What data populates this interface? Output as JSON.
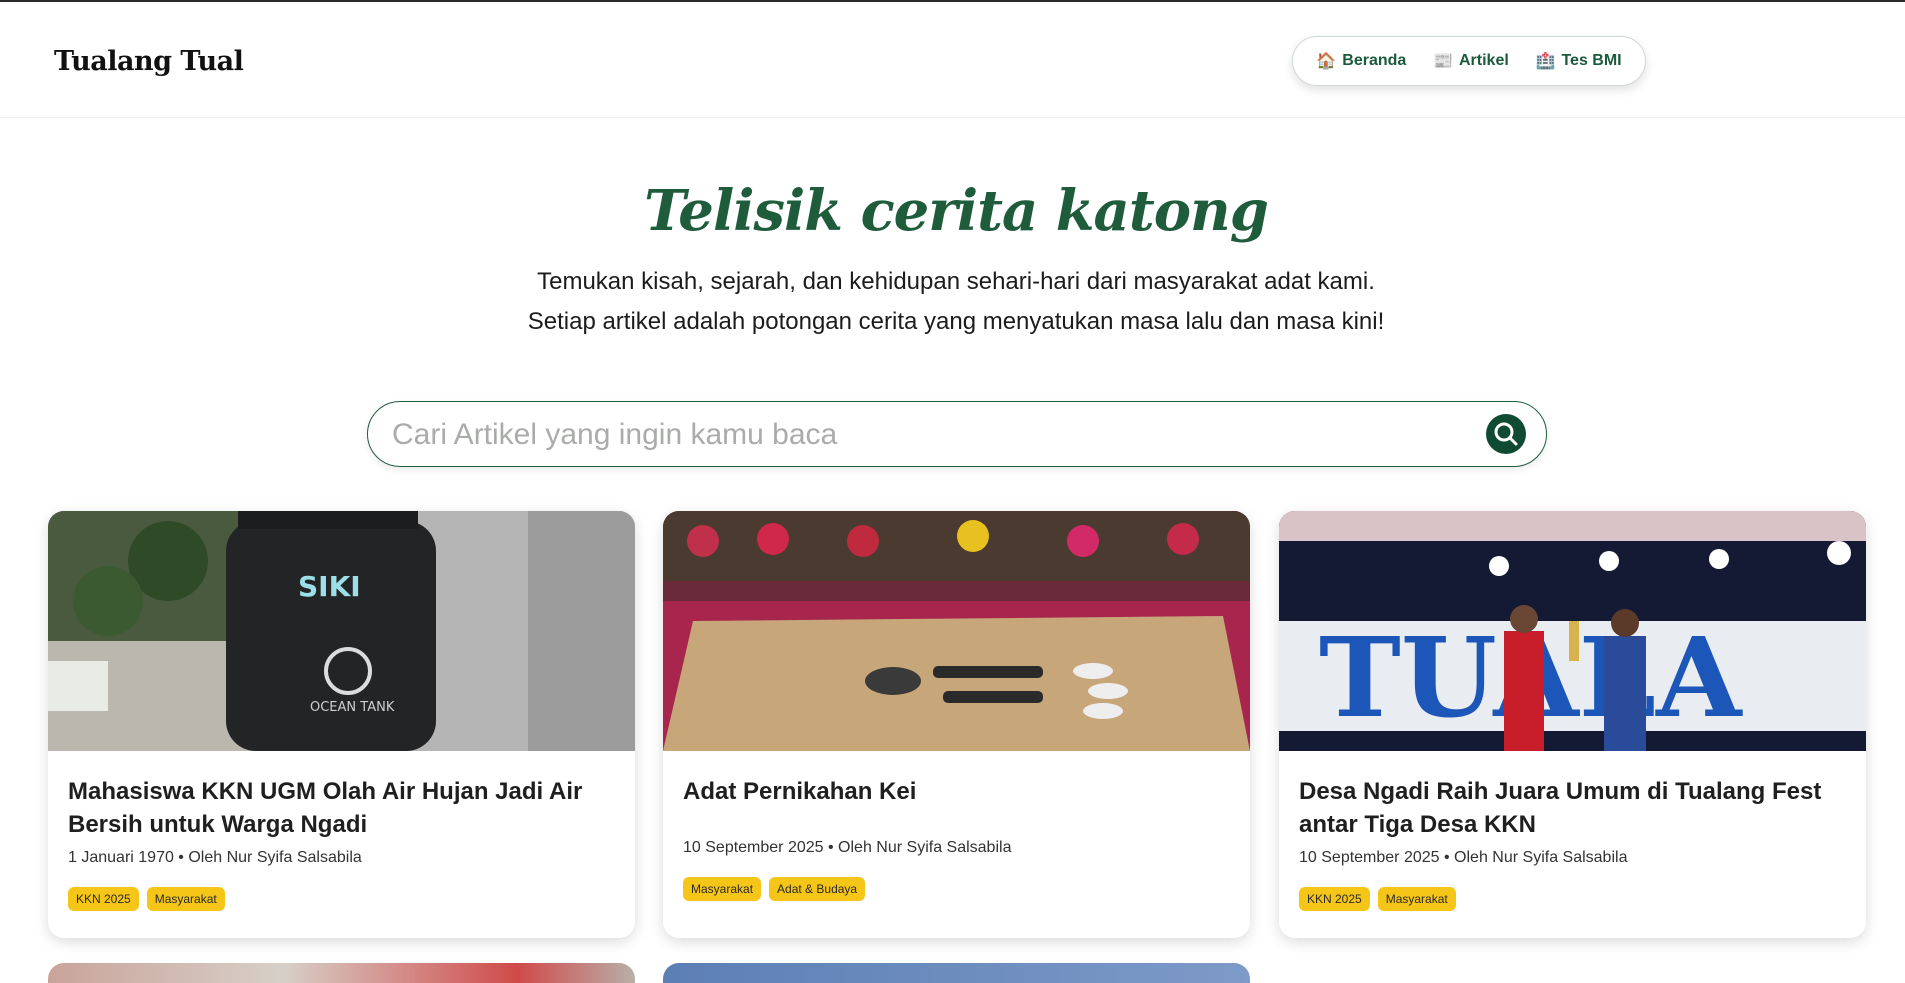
{
  "header": {
    "logo_text": "Tualang Tual",
    "nav": [
      {
        "icon": "🏠",
        "label": "Beranda"
      },
      {
        "icon": "📰",
        "label": "Artikel"
      },
      {
        "icon": "🏥",
        "label": "Tes BMI"
      }
    ]
  },
  "hero": {
    "title": "Telisik cerita katong",
    "subtitle_line1": "Temukan kisah, sejarah, dan kehidupan sehari-hari dari masyarakat adat kami.",
    "subtitle_line2": "Setiap artikel adalah potongan cerita yang menyatukan masa lalu dan masa kini!"
  },
  "search": {
    "placeholder": "Cari Artikel yang ingin kamu baca",
    "value": ""
  },
  "articles": [
    {
      "title": "Mahasiswa KKN UGM Olah Air Hujan Jadi Air Bersih untuk Warga Ngadi",
      "date": "1 Januari 1970",
      "author": "Oleh Nur Syifa Salsabila",
      "tags": [
        "KKN 2025",
        "Masyarakat"
      ],
      "image_text": "SIKI"
    },
    {
      "title": "Adat Pernikahan Kei",
      "date": "10 September 2025",
      "author": "Oleh Nur Syifa Salsabila",
      "tags": [
        "Masyarakat",
        "Adat & Budaya"
      ]
    },
    {
      "title": "Desa Ngadi Raih Juara Umum di Tualang Fest antar Tiga Desa KKN",
      "date": "10 September 2025",
      "author": "Oleh Nur Syifa Salsabila",
      "tags": [
        "KKN 2025",
        "Masyarakat"
      ],
      "image_text": "TUALA"
    }
  ],
  "colors": {
    "brand_green": "#1e5c3c",
    "tag_yellow": "#f5c518"
  }
}
